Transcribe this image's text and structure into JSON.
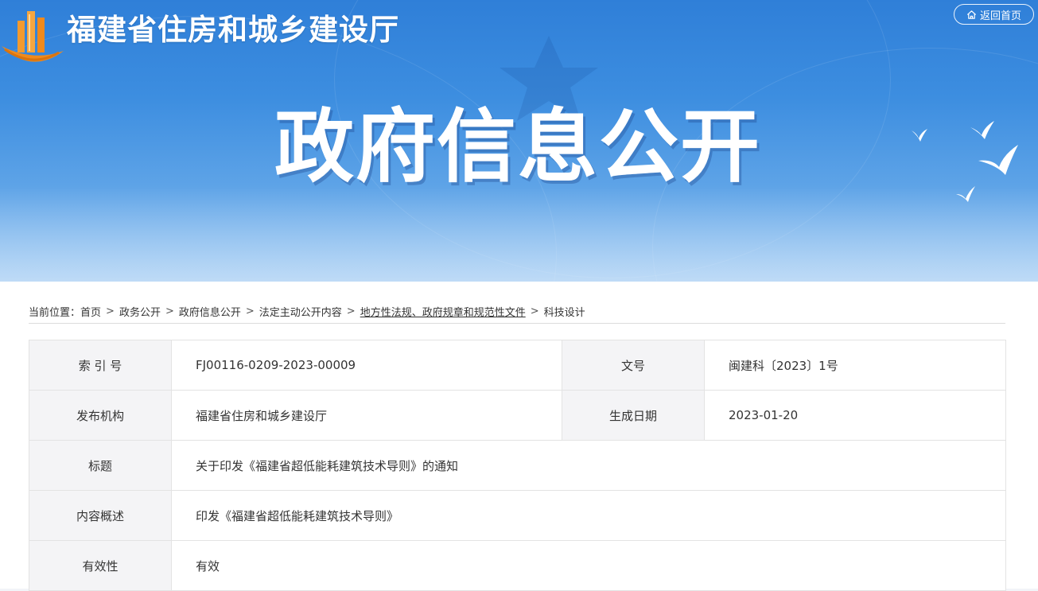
{
  "header": {
    "site_title": "福建省住房和城乡建设厅",
    "home_button": "返回首页",
    "home_icon": "home-icon",
    "hero_title": "政府信息公开"
  },
  "breadcrumb": {
    "prefix": "当前位置：",
    "items": [
      "首页",
      "政务公开",
      "政府信息公开",
      "法定主动公开内容",
      "地方性法规、政府规章和规范性文件",
      "科技设计"
    ],
    "separator": ">"
  },
  "meta_table": {
    "index_label": "索 引 号",
    "index_value": "FJ00116-0209-2023-00009",
    "doc_no_label": "文号",
    "doc_no_value": "闽建科〔2023〕1号",
    "publisher_label": "发布机构",
    "publisher_value": "福建省住房和城乡建设厅",
    "date_label": "生成日期",
    "date_value": "2023-01-20",
    "title_label": "标题",
    "title_value": "关于印发《福建省超低能耗建筑技术导则》的通知",
    "summary_label": "内容概述",
    "summary_value": "印发《福建省超低能耗建筑技术导则》",
    "validity_label": "有效性",
    "validity_value": "有效"
  },
  "colors": {
    "banner_top": "#2f7fd8",
    "banner_bottom": "#8ec1f0",
    "logo_orange": "#f08a1c",
    "text": "#333333",
    "label_bg": "#f4f4f6",
    "border": "#e3e3e3"
  }
}
